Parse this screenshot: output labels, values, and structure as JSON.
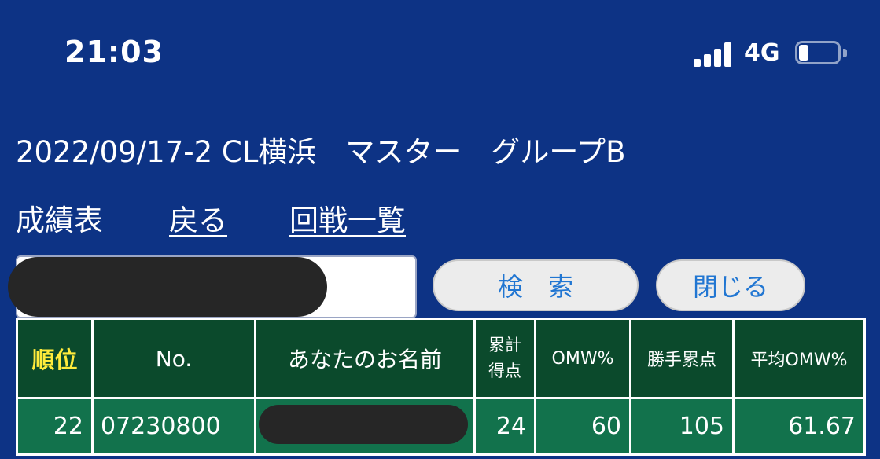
{
  "status_bar": {
    "time": "21:03",
    "network": "4G",
    "signal_bars": 4,
    "battery_level": 0.25
  },
  "event": {
    "title": "2022/09/17-2 CL横浜　マスター　グループB"
  },
  "nav": {
    "results_label": "成績表",
    "back_link": "戻る",
    "rounds_link": "回戦一覧"
  },
  "search": {
    "input_value": "",
    "search_button": "検　索",
    "close_button": "閉じる"
  },
  "table": {
    "headers": {
      "rank": "順位",
      "no": "No.",
      "name": "あなたのお名前",
      "points_line1": "累計",
      "points_line2": "得点",
      "omw": "OMW%",
      "win_points": "勝手累点",
      "avg_omw": "平均OMW%"
    },
    "rows": [
      {
        "rank": "22",
        "no": "07230800",
        "name": "",
        "points": "24",
        "omw": "60",
        "win_points": "105",
        "avg_omw": "61.67"
      }
    ]
  },
  "colors": {
    "background": "#0d3385",
    "header_cell": "#0b4a2c",
    "data_cell": "#12724c",
    "rank_header_text": "#ffeb3b",
    "button_text": "#2176d2"
  }
}
